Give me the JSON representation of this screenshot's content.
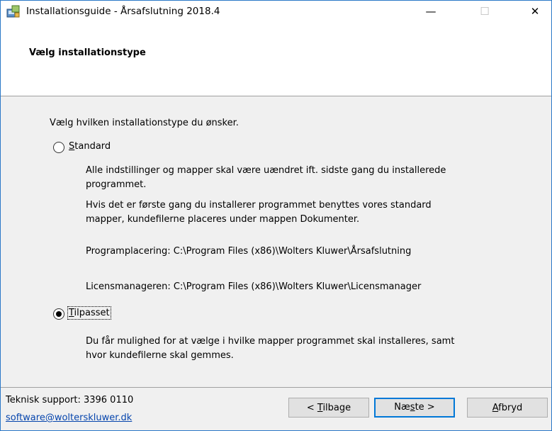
{
  "window": {
    "title": "Installationsguide - Årsafslutning 2018.4",
    "minimize_glyph": "—",
    "maximize_glyph": "☐",
    "close_glyph": "✕"
  },
  "header": {
    "title": "Vælg installationstype"
  },
  "content": {
    "prompt": "Vælg hvilken installationstype du ønsker.",
    "standard": {
      "label": "Standard",
      "selected": false,
      "desc1_line1": "Alle indstillinger og mapper skal være uændret ift. sidste gang du installerede",
      "desc1_line2": "programmet.",
      "desc2_line1": "Hvis det er første gang du installerer programmet benyttes vores standard",
      "desc2_line2": "mapper, kundefilerne placeres under mappen Dokumenter.",
      "program_location": "Programplacering: C:\\Program Files (x86)\\Wolters Kluwer\\Årsafslutning",
      "license_location": "Licensmanageren: C:\\Program Files (x86)\\Wolters Kluwer\\Licensmanager"
    },
    "custom": {
      "label": "Tilpasset",
      "selected": true,
      "desc_line1": "Du får mulighed for at vælge i hvilke mapper programmet skal installeres, samt",
      "desc_line2": "hvor kundefilerne skal gemmes."
    }
  },
  "footer": {
    "support": "Teknisk support: 3396 0110",
    "email": "software@wolterskluwer.dk",
    "back_prefix": "< ",
    "back_key": "T",
    "back_rest": "ilbage",
    "next_prefix": "Næ",
    "next_key": "s",
    "next_rest": "te >",
    "cancel_key": "A",
    "cancel_rest": "fbryd"
  }
}
